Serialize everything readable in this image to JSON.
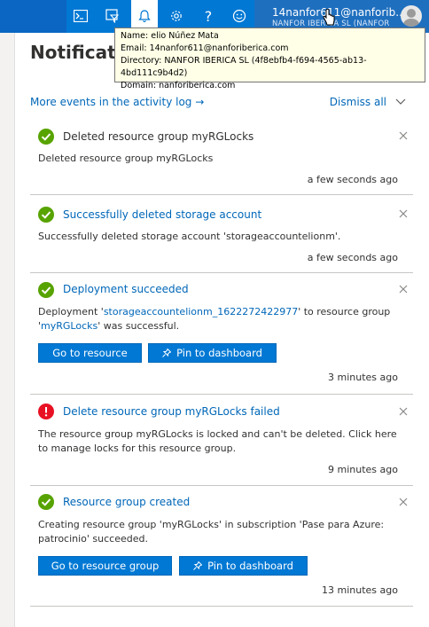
{
  "topbar": {
    "icons": [
      "cloud-shell-icon",
      "directory-filter-icon",
      "notifications-bell-icon",
      "settings-gear-icon",
      "help-question-icon",
      "feedback-smiley-icon"
    ],
    "help_glyph": "?",
    "user_name": "14nanfor611@nanforib...",
    "user_directory": "NANFOR IBERICA SL (NANFOR"
  },
  "tooltip": {
    "name_line": "Name: elio Núñez Mata",
    "email_line": "Email: 14nanfor611@nanforiberica.com",
    "directory_line": "Directory: NANFOR IBERICA SL (4f8ebfb4-f694-4565-ab13-4bd111c9b4d2)",
    "domain_line": "Domain: nanforiberica.com"
  },
  "panel": {
    "title": "Notificatio",
    "activity_link": "More events in the activity log →",
    "dismiss_all": "Dismiss all"
  },
  "notifications": [
    {
      "status": "success",
      "title": "Deleted resource group myRGLocks",
      "body": "Deleted resource group myRGLocks",
      "time": "a few seconds ago"
    },
    {
      "status": "success",
      "title": "Successfully deleted storage account",
      "body": "Successfully deleted storage account 'storageaccountelionm'.",
      "time": "a few seconds ago"
    },
    {
      "status": "success",
      "title": "Deployment succeeded",
      "body_prefix": "Deployment '",
      "body_link1": "storageaccountelionm_1622272422977",
      "body_mid": "' to resource group '",
      "body_link2": "myRGLocks",
      "body_suffix": "' was successful.",
      "button_primary": "Go to resource",
      "button_secondary": "Pin to dashboard",
      "time": "3 minutes ago"
    },
    {
      "status": "error",
      "title": "Delete resource group myRGLocks failed",
      "body": "The resource group myRGLocks is locked and can't be deleted. Click here to manage locks for this resource group.",
      "time": "9 minutes ago"
    },
    {
      "status": "success",
      "title": "Resource group created",
      "body": "Creating resource group 'myRGLocks' in subscription 'Pase para Azure: patrocinio' succeeded.",
      "button_primary": "Go to resource group",
      "button_secondary": "Pin to dashboard",
      "time": "13 minutes ago"
    }
  ],
  "colors": {
    "topbar": "#0078d4",
    "link": "#0067b8",
    "success": "#57a300",
    "error": "#e81123",
    "button": "#0078d4"
  }
}
